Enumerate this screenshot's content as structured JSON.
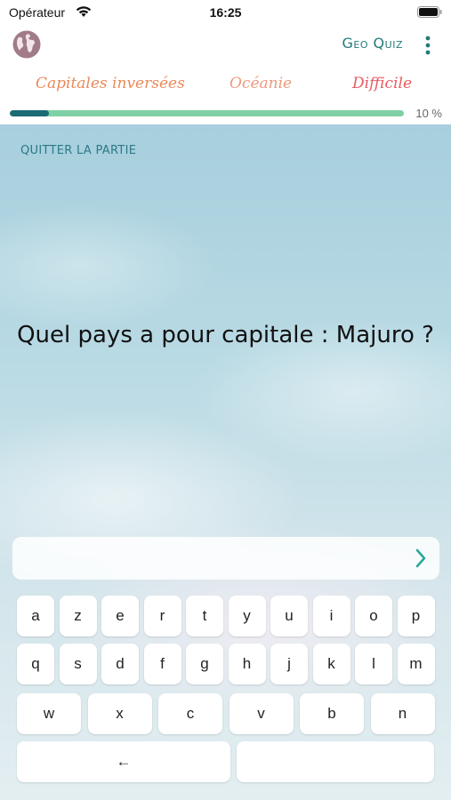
{
  "status_bar": {
    "carrier": "Opérateur",
    "time": "16:25"
  },
  "nav": {
    "title": "Geo Quiz",
    "left_icon": "globe-icon",
    "right_icon": "more-vertical-icon"
  },
  "info": {
    "mode": "Capitales inversées",
    "region": "Océanie",
    "level": "Difficile",
    "progress_value": 0.1,
    "progress_label": "10 %"
  },
  "game": {
    "quit_label": "QUITTER LA PARTIE",
    "question": "Quel pays a pour capitale : Majuro ?"
  },
  "answer": {
    "value": "",
    "placeholder": "",
    "submit_icon": "chevron-right-icon"
  },
  "keyboard": {
    "row1": [
      "a",
      "z",
      "e",
      "r",
      "t",
      "y",
      "u",
      "i",
      "o",
      "p"
    ],
    "row2": [
      "q",
      "s",
      "d",
      "f",
      "g",
      "h",
      "j",
      "k",
      "l",
      "m"
    ],
    "row3": [
      "w",
      "x",
      "c",
      "v",
      "b",
      "n"
    ],
    "backspace": "←",
    "space": ""
  },
  "colors": {
    "accent": "#247a7a",
    "progress_fill": "#1d6b73",
    "progress_track": "#7fd0a4",
    "mode": "#e98a5a",
    "region": "#ec9a7e",
    "level": "#e65c62"
  }
}
